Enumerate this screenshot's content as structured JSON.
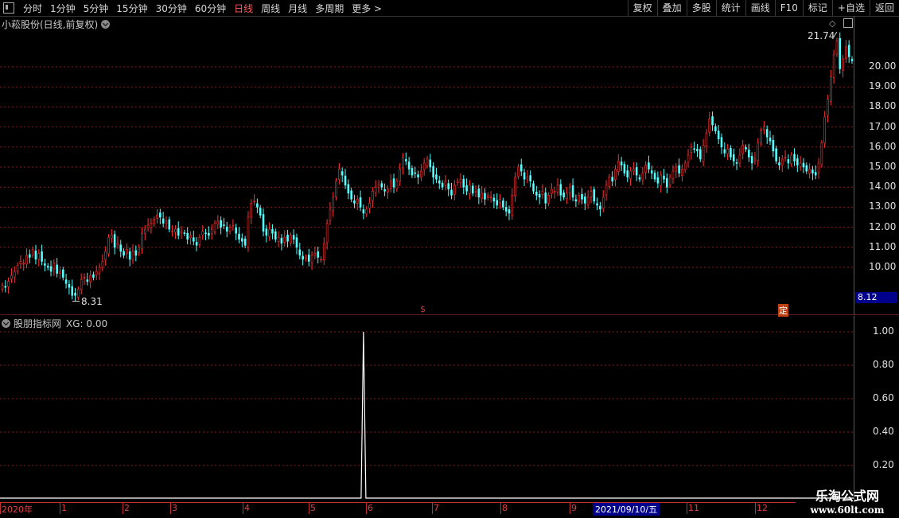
{
  "toolbar": {
    "periods": [
      "分时",
      "1分钟",
      "5分钟",
      "15分钟",
      "30分钟",
      "60分钟",
      "日线",
      "周线",
      "月线",
      "多周期",
      "更多 >"
    ],
    "active_period": "日线",
    "buttons": [
      "复权",
      "叠加",
      "多股",
      "统计",
      "画线",
      "F10",
      "标记",
      "+自选",
      "返回"
    ]
  },
  "main_panel": {
    "title": "小菘股份(日线,前复权)",
    "high_label": "21.74",
    "low_label": "8.31",
    "last_price": "8.12",
    "marker_s": "$",
    "marker_ding": "定",
    "y_ticks": [
      "20.00",
      "19.00",
      "18.00",
      "17.00",
      "16.00",
      "15.00",
      "14.00",
      "13.00",
      "12.00",
      "11.00",
      "10.00"
    ]
  },
  "indicator_panel": {
    "title": "股朋指标网",
    "series_label": "XG: 0.00",
    "y_ticks": [
      "1.00",
      "0.80",
      "0.60",
      "0.40",
      "0.20"
    ]
  },
  "timeline": {
    "labels": [
      "2020年",
      "1",
      "2",
      "3",
      "4",
      "5",
      "6",
      "7",
      "8",
      "9",
      "11",
      "12"
    ],
    "cursor_date": "2021/09/10/五"
  },
  "watermark": {
    "line1": "乐淘公式网",
    "line2": "www.60lt.com"
  },
  "chart_data": {
    "type": "candlestick",
    "title": "小菘股份(日线,前复权)",
    "ylim": [
      7.9,
      22.0
    ],
    "extremes": {
      "high": 21.74,
      "low": 8.31
    },
    "closes": [
      9.1,
      9.0,
      9.3,
      9.6,
      9.8,
      10.1,
      10.3,
      10.2,
      10.6,
      10.5,
      10.9,
      10.4,
      10.7,
      10.3,
      10.1,
      10.0,
      9.8,
      10.2,
      9.7,
      9.8,
      9.5,
      9.2,
      9.0,
      8.6,
      8.6,
      8.9,
      9.4,
      9.5,
      9.3,
      9.6,
      9.5,
      9.8,
      10.0,
      10.3,
      10.8,
      11.5,
      11.6,
      11.0,
      11.2,
      10.8,
      10.6,
      10.9,
      10.4,
      10.8,
      10.6,
      11.0,
      11.7,
      11.9,
      12.1,
      12.2,
      12.4,
      12.6,
      12.5,
      12.2,
      12.3,
      11.9,
      11.8,
      11.9,
      11.6,
      11.8,
      11.7,
      11.4,
      11.6,
      11.3,
      11.1,
      11.5,
      11.8,
      11.7,
      11.6,
      11.9,
      12.2,
      12.3,
      12.0,
      12.1,
      11.8,
      12.0,
      12.1,
      11.7,
      11.4,
      11.3,
      11.1,
      12.5,
      13.2,
      13.3,
      13.0,
      12.6,
      11.8,
      11.6,
      11.9,
      11.7,
      11.4,
      11.5,
      11.2,
      11.5,
      11.3,
      11.6,
      11.4,
      11.0,
      10.6,
      10.4,
      10.5,
      10.3,
      10.6,
      10.7,
      10.5,
      10.4,
      11.2,
      12.2,
      12.9,
      13.5,
      14.3,
      14.9,
      14.6,
      14.1,
      13.7,
      13.4,
      13.2,
      13.4,
      13.0,
      12.7,
      12.9,
      13.2,
      13.8,
      14.0,
      14.1,
      14.0,
      13.8,
      13.9,
      14.3,
      14.0,
      14.3,
      14.9,
      15.5,
      15.3,
      14.9,
      14.6,
      14.7,
      14.5,
      14.8,
      15.2,
      15.4,
      15.0,
      14.5,
      14.4,
      14.2,
      14.0,
      14.3,
      13.9,
      13.6,
      14.1,
      14.3,
      14.4,
      14.0,
      13.8,
      14.1,
      13.7,
      13.8,
      13.5,
      13.7,
      13.4,
      13.6,
      13.5,
      13.3,
      13.1,
      13.4,
      13.0,
      12.8,
      12.7,
      13.6,
      14.5,
      15.0,
      14.8,
      14.4,
      14.5,
      14.3,
      13.8,
      13.6,
      13.5,
      13.8,
      13.2,
      13.6,
      13.9,
      13.8,
      14.1,
      13.6,
      13.5,
      13.7,
      14.0,
      13.5,
      13.3,
      13.6,
      13.4,
      13.2,
      13.5,
      13.8,
      13.3,
      13.1,
      12.9,
      13.5,
      14.1,
      14.5,
      14.3,
      14.9,
      15.3,
      15.1,
      14.7,
      14.5,
      14.8,
      14.9,
      14.6,
      14.4,
      14.7,
      15.1,
      14.9,
      14.7,
      14.4,
      14.2,
      14.6,
      14.4,
      14.0,
      14.5,
      14.8,
      15.0,
      14.7,
      14.9,
      15.2,
      15.6,
      16.0,
      15.9,
      15.8,
      15.4,
      16.1,
      16.7,
      17.4,
      17.1,
      16.8,
      16.4,
      16.0,
      15.7,
      15.9,
      15.5,
      15.3,
      15.2,
      15.6,
      16.1,
      15.9,
      15.5,
      15.2,
      15.4,
      16.2,
      16.8,
      17.0,
      16.5,
      16.3,
      15.8,
      15.3,
      15.1,
      15.4,
      15.5,
      15.2,
      15.6,
      15.3,
      15.1,
      15.2,
      15.0,
      14.8,
      14.9,
      14.7,
      14.6,
      15.2,
      16.2,
      17.5,
      18.4,
      19.5,
      20.6,
      21.3,
      19.9,
      20.4,
      21.0,
      20.5,
      20.3
    ],
    "indicator": {
      "name": "XG",
      "value": 0.0,
      "signal_index": 119,
      "signal_value": 1.0
    }
  }
}
